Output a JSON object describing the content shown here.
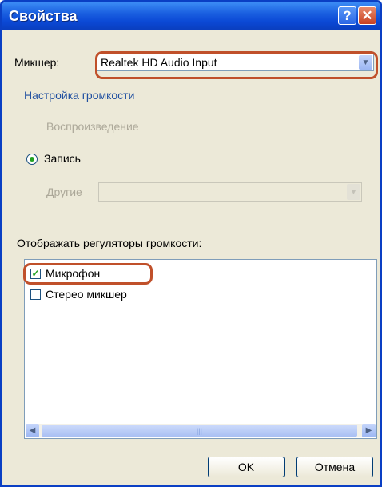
{
  "window": {
    "title": "Свойства"
  },
  "mixer": {
    "label": "Микшер:",
    "value": "Realtek HD Audio Input"
  },
  "volume_group": {
    "label": "Настройка громкости",
    "options": [
      "Воспроизведение",
      "Запись",
      "Другие"
    ],
    "selected": "Запись"
  },
  "controls": {
    "label": "Отображать регуляторы громкости:",
    "items": [
      {
        "label": "Микрофон",
        "checked": true
      },
      {
        "label": "Стерео микшер",
        "checked": false
      }
    ]
  },
  "buttons": {
    "ok": "OK",
    "cancel": "Отмена"
  },
  "colors": {
    "titlebar": "#0b49d6",
    "highlight": "#c0502a",
    "dialog_bg": "#ece9d8"
  }
}
